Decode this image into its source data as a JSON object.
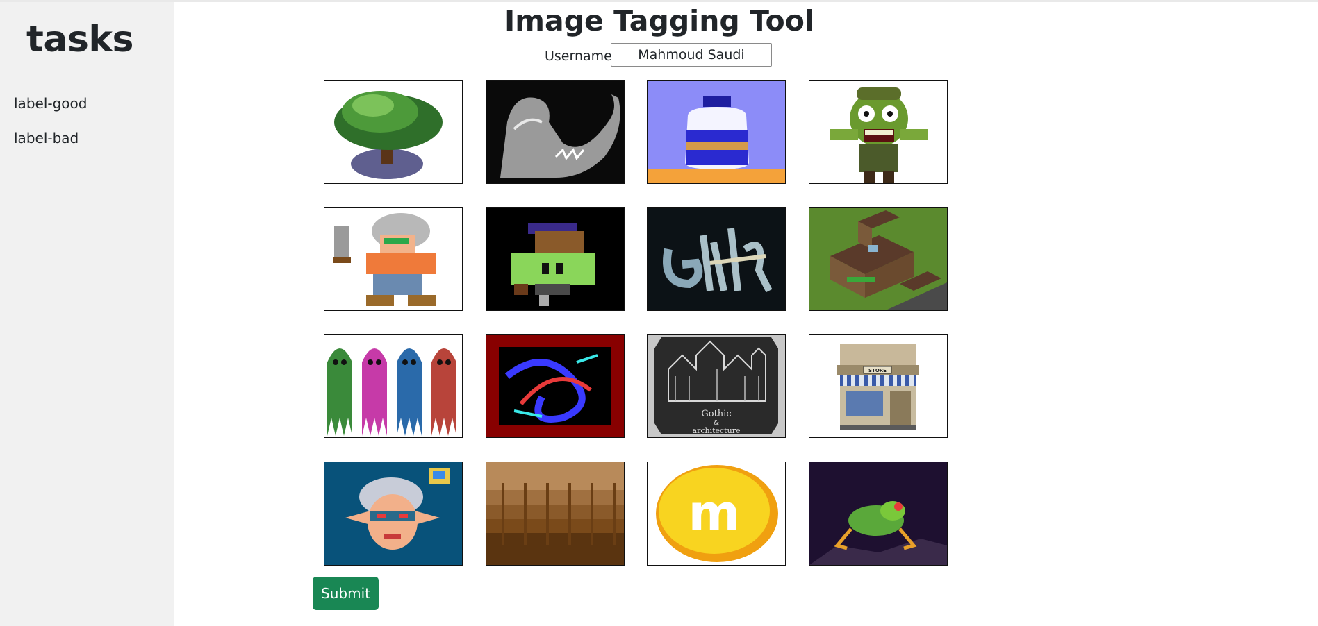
{
  "sidebar": {
    "title": "tasks",
    "items": [
      {
        "label": "label-good"
      },
      {
        "label": "label-bad"
      }
    ]
  },
  "header": {
    "title": "Image Tagging Tool",
    "username_label": "Username",
    "username_value": "Mahmoud Saudi"
  },
  "gallery": {
    "images": [
      {
        "subject": "tree"
      },
      {
        "subject": "dinosaur"
      },
      {
        "subject": "potion-jar"
      },
      {
        "subject": "zombie"
      },
      {
        "subject": "knife-warrior"
      },
      {
        "subject": "green-monster"
      },
      {
        "subject": "graffiti-text"
      },
      {
        "subject": "isometric-house"
      },
      {
        "subject": "ghosts"
      },
      {
        "subject": "abstract-swirl"
      },
      {
        "subject": "gothic-architecture"
      },
      {
        "subject": "store-building"
      },
      {
        "subject": "elf-face"
      },
      {
        "subject": "brown-pattern"
      },
      {
        "subject": "m-candy"
      },
      {
        "subject": "frog"
      }
    ],
    "gothic_caption": "Gothic",
    "gothic_amp": "&",
    "gothic_subcaption": "architecture",
    "store_sign": "STORE",
    "candy_letter": "m"
  },
  "actions": {
    "submit_label": "Submit"
  },
  "colors": {
    "submit": "#198754",
    "sidebar_bg": "#f1f1f1"
  }
}
